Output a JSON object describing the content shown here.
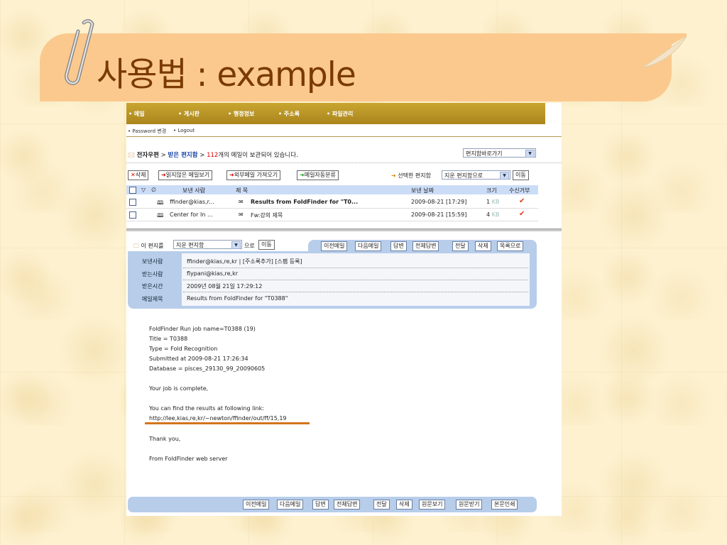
{
  "slide": {
    "title": "사용법 : example"
  },
  "nav": {
    "items": [
      "• 메일",
      "• 게시판",
      "• 행정정보",
      "• 주소록",
      "• 파일관리"
    ],
    "sub": [
      "• Password 변경",
      "• Logout"
    ]
  },
  "breadcrumb": {
    "root": "전자우편",
    "sep1": " > ",
    "folder": "받은 편지함",
    "sep2": " > ",
    "count": "112",
    "suffix": "개의 메일이 보관되어 있습니다."
  },
  "quick_folder": "편지함바로가기",
  "toolbar": {
    "delete": "삭제",
    "unread": "읽지않은 메일보기",
    "fetch": "외부메일 가져오기",
    "auto_sort": "메일자동분류",
    "move_label": "선택한 편지함",
    "move_target": "지운 편지함으로",
    "move_btn": "이동"
  },
  "list": {
    "columns": {
      "from": "보낸 사람",
      "subject": "제 목",
      "date": "보낸 날짜",
      "size": "크기",
      "reject": "수신거부"
    },
    "rows": [
      {
        "from": "ffinder@kias,r...",
        "subject": "Results from FoldFinder for \"T0...",
        "date": "2009-08-21 [17:29]",
        "size": "1",
        "unit": "KB",
        "bold": true
      },
      {
        "from": "Center for In ...",
        "subject": "Fw:강의 제목",
        "date": "2009-08-21 [15:59]",
        "size": "4",
        "unit": "KB",
        "bold": false
      }
    ]
  },
  "viewer": {
    "move_label": "이 편지를",
    "move_target": "지운 편지함",
    "move_suffix": "으로",
    "move_btn": "이동",
    "buttons": [
      "이전메일",
      "다음메일",
      "답변",
      "전체답변",
      "전달",
      "삭제",
      "목록으로"
    ],
    "header": {
      "from_label": "보낸사람",
      "from": "ffinder@kias,re,kr | [주소록추가] [스팸 등록]",
      "to_label": "받는사람",
      "to": "flypani@kias,re,kr",
      "time_label": "받은시간",
      "time": "2009년 08월 21일 17:29:12",
      "subject_label": "메일제목",
      "subject": "Results from FoldFinder for \"T0388\""
    },
    "body": [
      "FoldFinder Run job name=T0388 (19)",
      "Title = T0388",
      "Type = Fold Recognition",
      "Submitted at 2009-08-21 17:26:34",
      "Database = pisces_29130_99_20090605",
      "Your job is complete,",
      "You can find the results at following link:",
      "http://lee,kias,re,kr/~newton/ffinder/out/ff/15,19",
      "Thank you,",
      "From FoldFinder web server"
    ],
    "footer_buttons": [
      "이전메일",
      "다음메일",
      "답변",
      "전체답변",
      "전달",
      "삭제",
      "원문보기",
      "원문받기",
      "본문인쇄"
    ]
  },
  "colors": {
    "title_bar": "#fbc98e",
    "nav": "#b08c22",
    "panel": "#b7cdea",
    "highlight": "#d4741a"
  }
}
